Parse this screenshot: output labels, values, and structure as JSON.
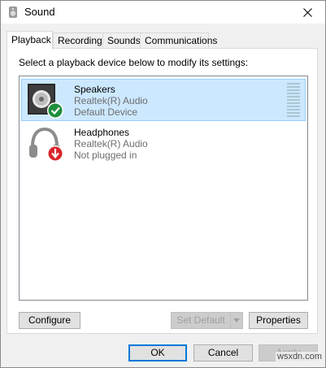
{
  "window": {
    "title": "Sound",
    "icon": "speaker-icon",
    "close_glyph": "✕"
  },
  "tabs": [
    {
      "label": "Playback",
      "active": true
    },
    {
      "label": "Recording",
      "active": false
    },
    {
      "label": "Sounds",
      "active": false
    },
    {
      "label": "Communications",
      "active": false
    }
  ],
  "panel": {
    "instruction": "Select a playback device below to modify its settings:",
    "devices": [
      {
        "name": "Speakers",
        "driver": "Realtek(R) Audio",
        "status": "Default Device",
        "icon": "speaker-icon",
        "badge": "check-badge-icon",
        "selected": true
      },
      {
        "name": "Headphones",
        "driver": "Realtek(R) Audio",
        "status": "Not plugged in",
        "icon": "headphones-icon",
        "badge": "unplugged-arrow-icon",
        "selected": false
      }
    ],
    "buttons": {
      "configure": "Configure",
      "set_default": "Set Default",
      "properties": "Properties"
    }
  },
  "footer": {
    "ok": "OK",
    "cancel": "Cancel",
    "apply": "Apply"
  },
  "watermark": "wsxdn.com",
  "colors": {
    "selection_bg": "#cce8ff",
    "selection_border": "#99d1ff",
    "default_button_border": "#0078d7",
    "check_badge": "#1e8f3c",
    "unplugged_badge": "#d9262b"
  }
}
